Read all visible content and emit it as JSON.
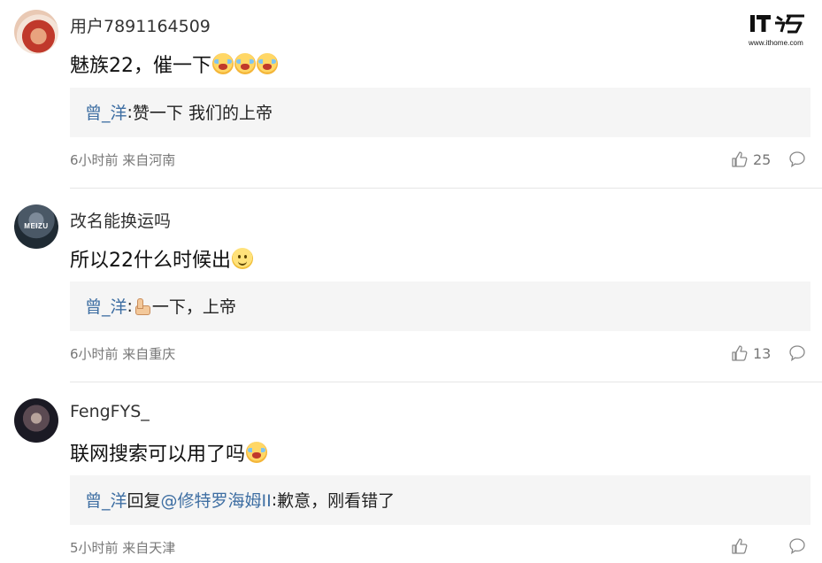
{
  "brand": {
    "logo_text": "IT之家",
    "url_text": "www.ithome.com"
  },
  "comments": [
    {
      "username": "用户7891164509",
      "avatar_icon": "user-avatar-icon",
      "content": "魅族22，催一下",
      "content_emojis": [
        "cry-emoji-icon",
        "cry-emoji-icon",
        "cry-emoji-icon"
      ],
      "reply": {
        "user": "曾_洋",
        "connector": "",
        "target": "",
        "separator": ":",
        "text": "赞一下 我们的上帝"
      },
      "meta": "6小时前 来自河南",
      "likes": "25"
    },
    {
      "username": "改名能换运吗",
      "avatar_icon": "meizu-avatar-icon",
      "avatar_text": "MEIZU",
      "content": "所以22什么时候出",
      "content_emojis": [
        "smile-emoji-icon"
      ],
      "reply": {
        "user": "曾_洋",
        "connector": "",
        "target": "",
        "separator": ":",
        "emoji": "thumbs-up-emoji-icon",
        "text": "一下，上帝"
      },
      "meta": "6小时前 来自重庆",
      "likes": "13"
    },
    {
      "username": "FengFYS_",
      "avatar_icon": "dark-avatar-icon",
      "content": "联网搜索可以用了吗",
      "content_emojis": [
        "cry-emoji-icon"
      ],
      "reply": {
        "user": "曾_洋",
        "connector": "回复",
        "target": "@修特罗海姆II",
        "separator": ":",
        "text": "歉意，刚看错了"
      },
      "meta": "5小时前 来自天津",
      "likes": ""
    }
  ]
}
